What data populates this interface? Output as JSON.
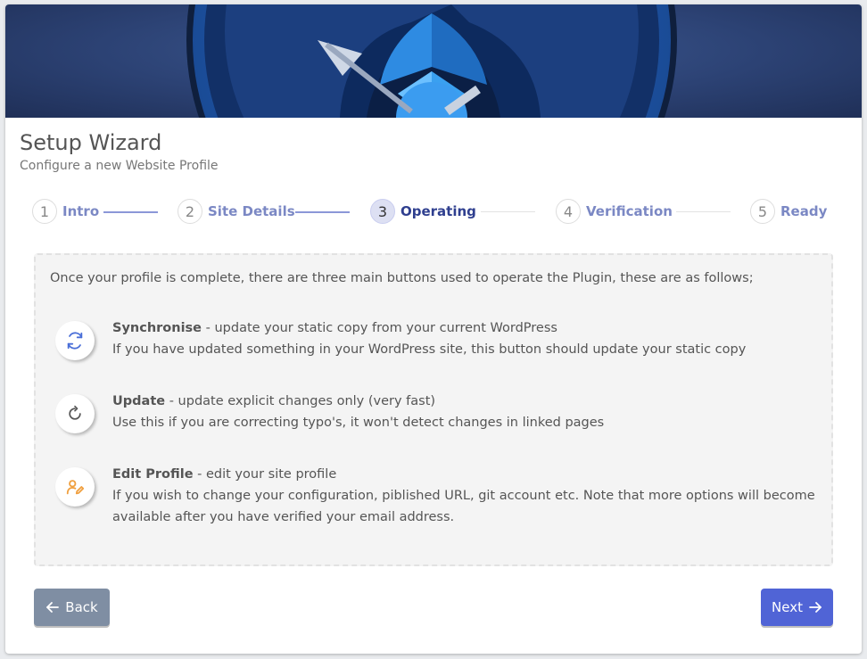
{
  "header": {
    "title": "Setup Wizard",
    "subtitle": "Configure a new Website Profile"
  },
  "steps": [
    {
      "num": "1",
      "label": "Intro",
      "state": "done"
    },
    {
      "num": "2",
      "label": "Site Details",
      "state": "done"
    },
    {
      "num": "3",
      "label": "Operating",
      "state": "active"
    },
    {
      "num": "4",
      "label": "Verification",
      "state": "todo"
    },
    {
      "num": "5",
      "label": "Ready",
      "state": "todo"
    }
  ],
  "panel": {
    "intro": "Once your profile is complete, there are three main buttons used to operate the Plugin, these are as follows;",
    "items": [
      {
        "icon": "sync-icon",
        "title": "Synchronise",
        "desc": " - update your static copy from your current WordPress",
        "detail": "If you have updated something in your WordPress site, this button should update your static copy"
      },
      {
        "icon": "refresh-icon",
        "title": "Update",
        "desc": " - update explicit changes only (very fast)",
        "detail": "Use this if you are correcting typo's, it won't detect changes in linked pages"
      },
      {
        "icon": "user-edit-icon",
        "title": "Edit Profile",
        "desc": " - edit your site profile",
        "detail": "If you wish to change your configuration, piblished URL, git account etc. Note that more options will become available after you have verified your email address."
      }
    ]
  },
  "buttons": {
    "back": "Back",
    "next": "Next"
  },
  "colors": {
    "accent": "#5064d6",
    "back": "#7f8ea3",
    "step_done": "#8b97d8",
    "step_active": "#2f3f8f",
    "edit_icon": "#f0a040"
  }
}
